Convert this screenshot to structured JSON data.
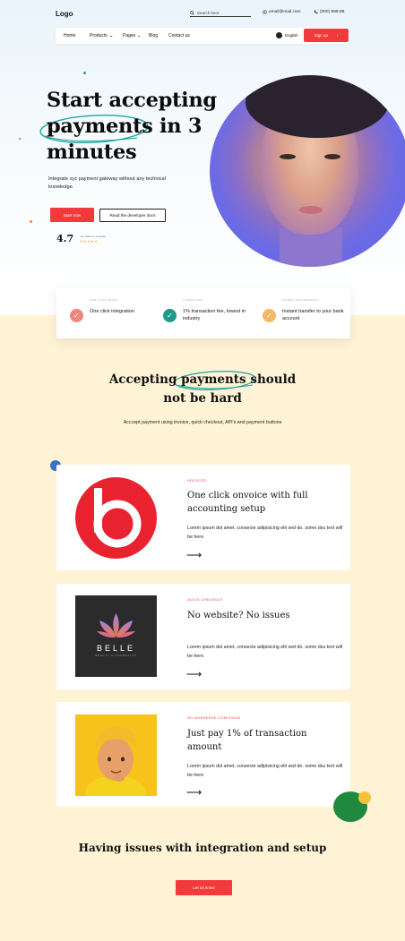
{
  "header": {
    "logo": "Logo",
    "search_placeholder": "Search here.",
    "email": "email@mail.com",
    "phone": "(000) 888-88"
  },
  "nav": {
    "items": [
      {
        "label": "Home"
      },
      {
        "label": "Products"
      },
      {
        "label": "Pages"
      },
      {
        "label": "Blog"
      },
      {
        "label": "Contact us"
      }
    ],
    "language": "English",
    "signup_label": "Sign up",
    "signup_arrow": "›"
  },
  "hero": {
    "title_line1": "Start accepting",
    "title_line2": "payments in 3",
    "title_line3": "minutes",
    "description": "Integrate xyz payment gateway without any technical knowledge.",
    "start_label": "Start now",
    "docs_label": "Read the developer docs",
    "rating_value": "4.7",
    "rating_label": "You rated on trustpilot",
    "rating_stars": "★★★★★",
    "rating_score": 5
  },
  "features": [
    {
      "tag": "ONE CLICK SETUP",
      "text": "One click integration",
      "color": "#f0857c",
      "icon": "check-icon"
    },
    {
      "tag": "LOWEST FEE",
      "text": "1% transaction fee, lowest in industry",
      "color": "#1f9a8a",
      "icon": "check-icon"
    },
    {
      "tag": "GLOBAL WITHDRAWALS",
      "text": "Instant transfer to your bank account",
      "color": "#f4b765",
      "icon": "check-icon"
    }
  ],
  "section": {
    "title_line1": "Accepting payments should",
    "title_line2": "not be hard",
    "subtitle": "Acccept payment using invoice, quick checkout, API's and  payment buttons"
  },
  "cards": [
    {
      "kicker": "INVOICES",
      "title": "One click onvoice with full accounting setup",
      "body": "Lorem ipsum dol amet, consecte adipisicing elit sed do. some dsu text will be here.",
      "arrow": "⟶"
    },
    {
      "kicker": "QUICK CHECKOUT",
      "title": "No website? No issues",
      "body": "Lorem ipsum dol amet, consecte adipisicing elit sed do. some dsu text will be here.",
      "arrow": "⟶",
      "logo_name": "BELLE",
      "logo_sub": "BEAUTY & COSMETICS"
    },
    {
      "kicker": "NO-NONSENSE COMISSION",
      "title": "Just pay 1% of transaction amount",
      "body": "Lorem ipsum dol amet, consecte adipisicing elit sed do. some dsu text will be here.",
      "arrow": "⟶"
    }
  ],
  "footer_cta": {
    "title": "Having issues with integration and setup",
    "button_label": "Let us know"
  },
  "colors": {
    "accent": "#f23a3c",
    "cream": "#fff3d6",
    "teal": "#1f9a8a"
  }
}
